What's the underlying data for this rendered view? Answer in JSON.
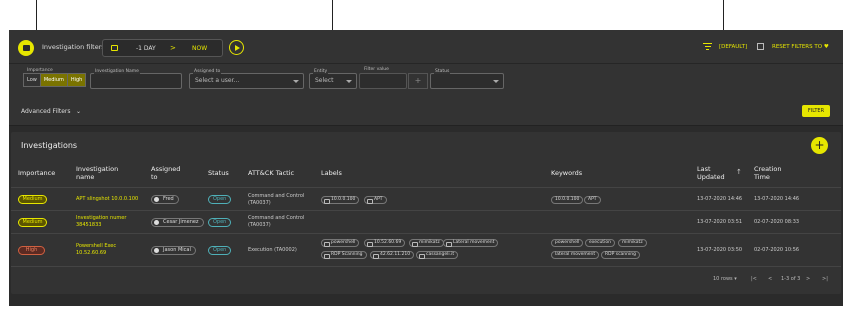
{
  "topbar": {
    "title": "Investigation filters",
    "time_from": "-1 DAY",
    "time_arrow": ">",
    "time_to": "NOW",
    "default_label": "[DEFAULT]",
    "reset_label": "RESET FILTERS TO"
  },
  "filters": {
    "importance_label": "Importance",
    "importance_options": [
      "Low",
      "Medium",
      "High"
    ],
    "investigation_name_label": "Investigation Name",
    "investigation_name_value": "",
    "assigned_to_label": "Assigned to",
    "assigned_to_placeholder": "Select a user...",
    "entity_label": "Entity",
    "entity_placeholder": "Select",
    "filter_value_label": "Filter value",
    "add_symbol": "+",
    "status_label": "Status",
    "advanced_label": "Advanced Filters",
    "filter_button": "FILTER"
  },
  "investigations": {
    "title": "Investigations",
    "add_symbol": "+",
    "columns": {
      "importance": "Importance",
      "name_1": "Investigation",
      "name_2": "name",
      "assigned_1": "Assigned",
      "assigned_2": "to",
      "status": "Status",
      "tactic": "ATT&CK Tactic",
      "labels": "Labels",
      "keywords": "Keywords",
      "last_updated_1": "Last",
      "last_updated_2": "Updated",
      "creation_1": "Creation",
      "creation_2": "Time"
    },
    "rows": [
      {
        "importance": "Medium",
        "name_1": "APT slingshot 10.0.0.100",
        "name_2": "",
        "assigned": "Fred",
        "status": "Open",
        "tactic_1": "Command and Control",
        "tactic_2": "(TA0037)",
        "labels": [
          "10.0.0.100",
          "APT"
        ],
        "keywords": [
          "10.0.0.100",
          "APT"
        ],
        "last_updated": "13-07-2020 14:46",
        "creation": "13-07-2020 14:46"
      },
      {
        "importance": "Medium",
        "name_1": "Investigation numer",
        "name_2": "38451833",
        "assigned": "Cesar Jimenez",
        "status": "Open",
        "tactic_1": "Command and Control",
        "tactic_2": "(TA0037)",
        "labels": [],
        "keywords": [],
        "last_updated": "13-07-2020 03:51",
        "creation": "02-07-2020 08:33"
      },
      {
        "importance": "High",
        "name_1": "Powershell Exec",
        "name_2": "10.52.60.69",
        "assigned": "Jason Mical",
        "status": "Open",
        "tactic_1": "Execution (TA0002)",
        "tactic_2": "",
        "labels": [
          "powershell",
          "10.52.60.69",
          "mimikatz",
          "Lateral movement",
          "RDP Scanning",
          "42.62.11.210",
          "cassangeli.it"
        ],
        "keywords": [
          "powershell",
          "execution",
          "mimikatz",
          "lateral movement",
          "RDP scanning"
        ],
        "last_updated": "13-07-2020 03:50",
        "creation": "02-07-2020 10:56"
      }
    ],
    "pager": {
      "rows_label": "10 rows",
      "range": "1-3 of 3",
      "first": "|<",
      "prev": "<",
      "next": ">",
      "last": ">|"
    }
  },
  "colors": {
    "accent": "#e6e600",
    "panel": "#333333",
    "background": "#2b2b2b",
    "status_open": "#4fb0b8",
    "high": "#e88060"
  }
}
